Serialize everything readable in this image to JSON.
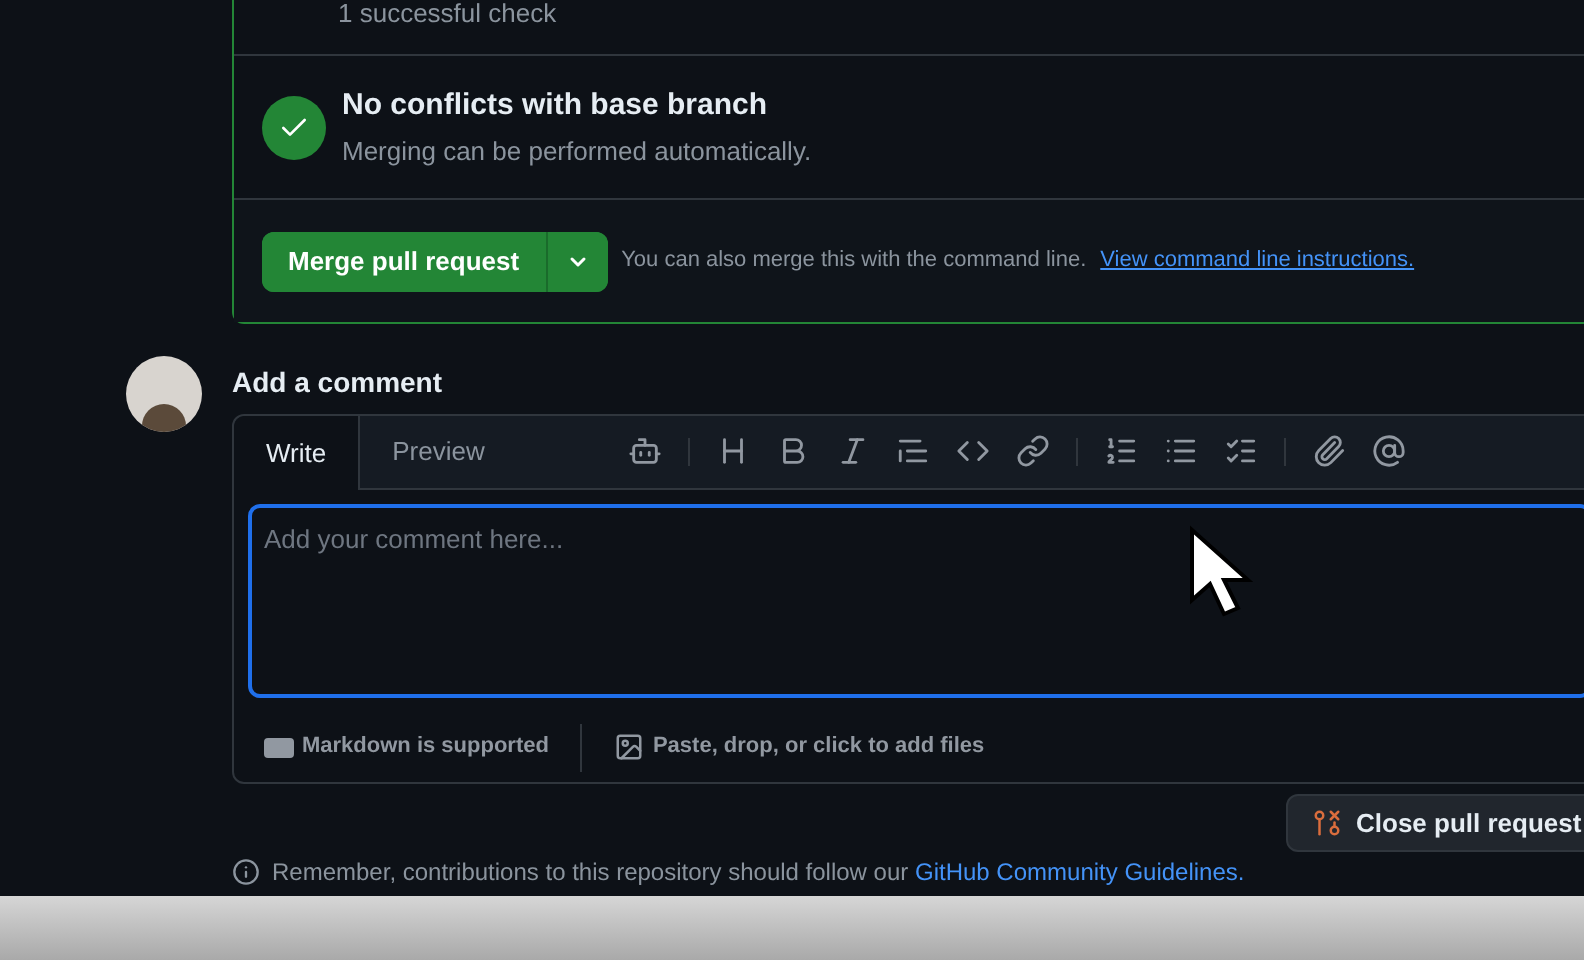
{
  "checks": {
    "summary": "1 successful check"
  },
  "conflicts": {
    "title": "No conflicts with base branch",
    "subtitle": "Merging can be performed automatically."
  },
  "merge": {
    "button": "Merge pull request",
    "hint": "You can also merge this with the command line.",
    "link": "View command line instructions."
  },
  "comment": {
    "heading": "Add a comment",
    "tabs": [
      {
        "label": "Write",
        "selected": true
      },
      {
        "label": "Preview",
        "selected": false
      }
    ],
    "placeholder": "Add your comment here...",
    "markdown_note": "Markdown is supported",
    "attach_note": "Paste, drop, or click to add files"
  },
  "close_button": "Close pull request",
  "footer": {
    "text": "Remember, contributions to this repository should follow our",
    "link": "GitHub Community Guidelines."
  }
}
